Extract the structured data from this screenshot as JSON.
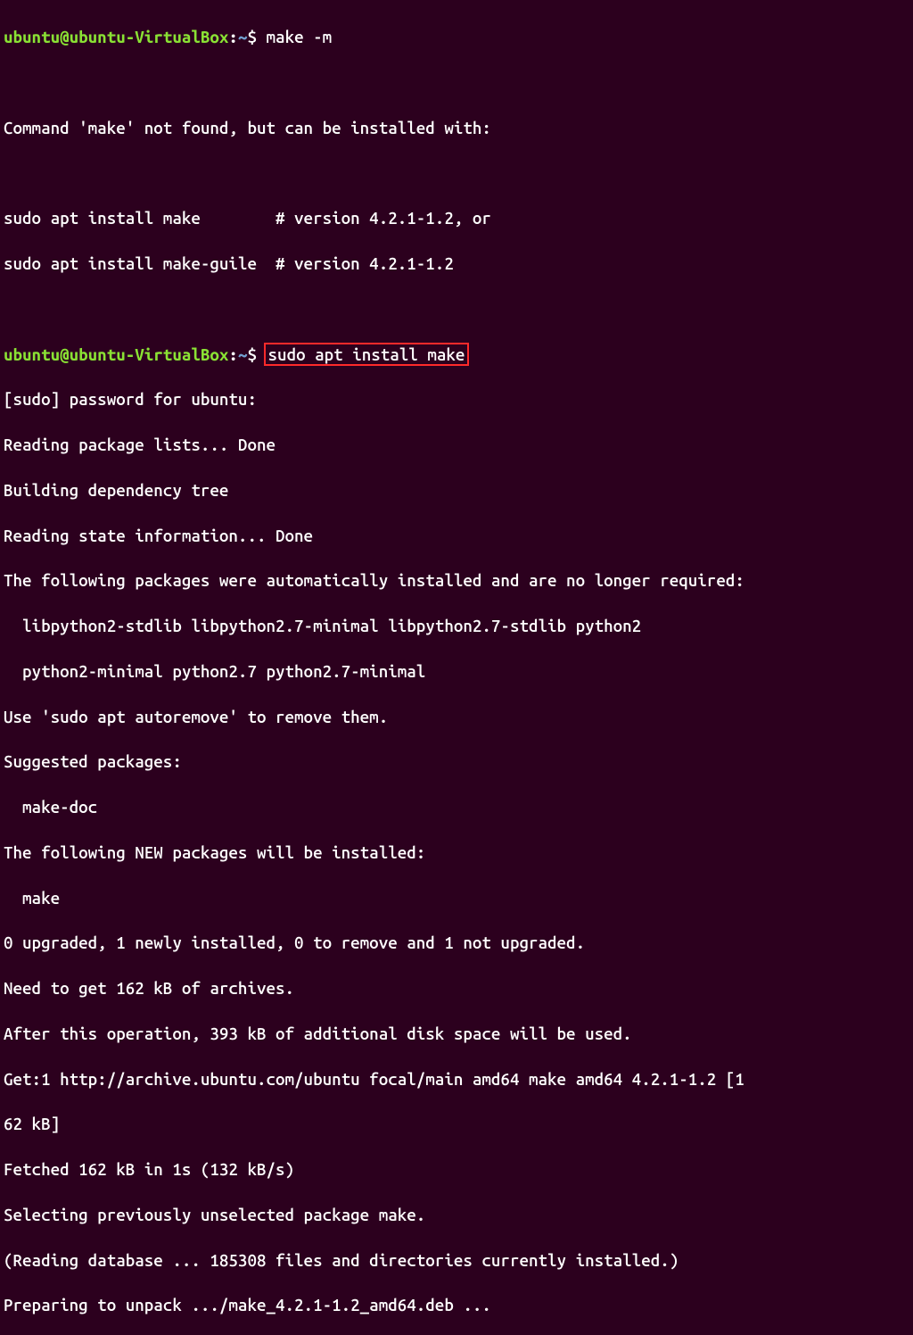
{
  "prompt": {
    "user_host": "ubuntu@ubuntu-VirtualBox",
    "colon": ":",
    "path": "~",
    "dollar": "$ "
  },
  "cmd1": "make -m",
  "blank": " ",
  "out1": "Command 'make' not found, but can be installed with:",
  "out2": "sudo apt install make        # version 4.2.1-1.2, or",
  "out3": "sudo apt install make-guile  # version 4.2.1-1.2",
  "cmd2": "sudo apt install make",
  "out4": "[sudo] password for ubuntu:",
  "out5": "Reading package lists... Done",
  "out6": "Building dependency tree",
  "out7": "Reading state information... Done",
  "out8": "The following packages were automatically installed and are no longer required:",
  "out9": "  libpython2-stdlib libpython2.7-minimal libpython2.7-stdlib python2",
  "out10": "  python2-minimal python2.7 python2.7-minimal",
  "out11": "Use 'sudo apt autoremove' to remove them.",
  "out12": "Suggested packages:",
  "out13": "  make-doc",
  "out14": "The following NEW packages will be installed:",
  "out15": "  make",
  "out16": "0 upgraded, 1 newly installed, 0 to remove and 1 not upgraded.",
  "out17": "Need to get 162 kB of archives.",
  "out18": "After this operation, 393 kB of additional disk space will be used.",
  "out19": "Get:1 http://archive.ubuntu.com/ubuntu focal/main amd64 make amd64 4.2.1-1.2 [1",
  "out20": "62 kB]",
  "out21": "Fetched 162 kB in 1s (132 kB/s)",
  "out22": "Selecting previously unselected package make.",
  "out23": "(Reading database ... 185308 files and directories currently installed.)",
  "out24": "Preparing to unpack .../make_4.2.1-1.2_amd64.deb ..."
}
